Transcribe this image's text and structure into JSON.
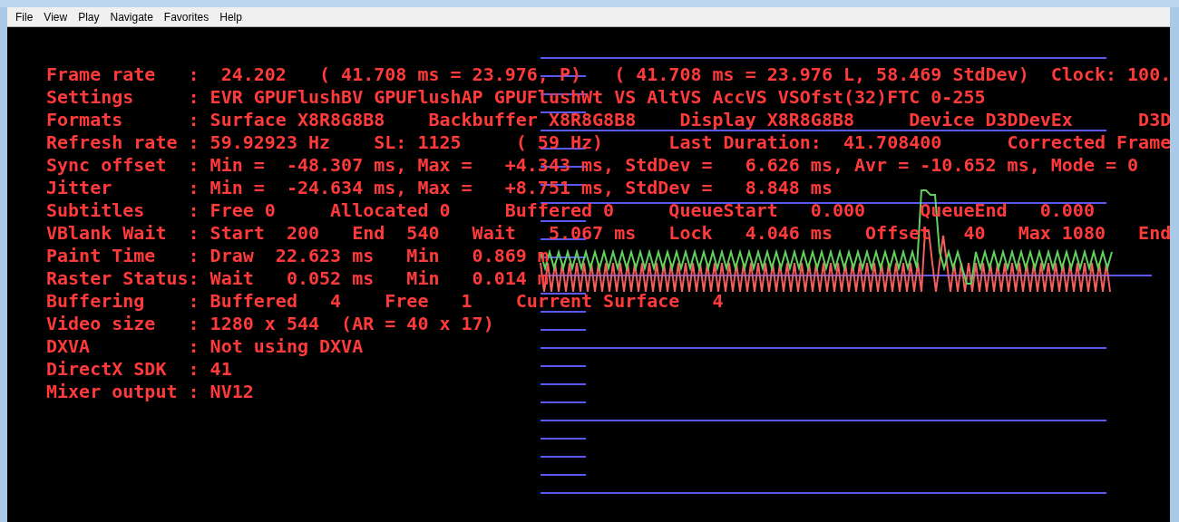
{
  "menu": [
    "File",
    "View",
    "Play",
    "Navigate",
    "Favorites",
    "Help"
  ],
  "stats": [
    "Frame rate   :  24.202   ( 41.708 ms = 23.976, P)   ( 41.708 ms = 23.976 L, 58.469 StdDev)  Clock: 100.",
    "Settings     : EVR GPUFlushBV GPUFlushAP GPUFlushWt VS AltVS AccVS VSOfst(32)FTC 0-255",
    "Formats      : Surface X8R8G8B8    Backbuffer X8R8G8B8    Display X8R8G8B8     Device D3DDevEx      D3D",
    "Refresh rate : 59.92923 Hz    SL: 1125     ( 59 Hz)      Last Duration:  41.708400      Corrected Frame",
    "Sync offset  : Min =  -48.307 ms, Max =   +4.343 ms, StdDev =   6.626 ms, Avr = -10.652 ms, Mode = 0",
    "Jitter       : Min =  -24.634 ms, Max =   +8.751 ms, StdDev =   8.848 ms",
    "Subtitles    : Free 0     Allocated 0     Buffered 0     QueueStart   0.000     QueueEnd   0.000",
    "VBlank Wait  : Start  200   End  540   Wait   5.067 ms   Lock   4.046 ms   Offset   40   Max 1080   End",
    "Paint Time   : Draw  22.623 ms   Min   0.869 m",
    "Raster Status: Wait   0.052 ms   Min   0.014 m",
    "Buffering    : Buffered   4    Free   1    Current Surface   4",
    "Video size   : 1280 x 544  (AR = 40 x 17)",
    "DXVA         : Not using DXVA",
    "DirectX SDK  : 41",
    "Mixer output : NV12"
  ]
}
